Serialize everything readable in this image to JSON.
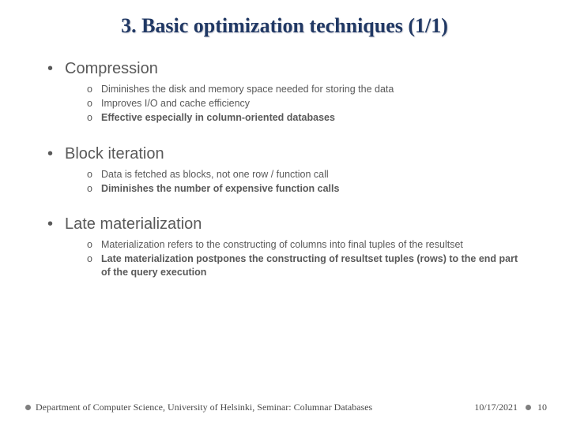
{
  "title": "3. Basic optimization techniques (1/1)",
  "sections": [
    {
      "heading": "Compression",
      "items": [
        {
          "text": "Diminishes the disk and memory space needed for storing the data",
          "bold": false
        },
        {
          "text": "Improves I/O and cache efficiency",
          "bold": false
        },
        {
          "text": "Effective especially in column-oriented databases",
          "bold": true
        }
      ]
    },
    {
      "heading": "Block iteration",
      "items": [
        {
          "text": "Data is fetched as blocks, not one row / function call",
          "bold": false
        },
        {
          "text": "Diminishes the number of expensive function calls",
          "bold": true
        }
      ]
    },
    {
      "heading": "Late materialization",
      "items": [
        {
          "text": "Materialization refers to the constructing of columns into final tuples of the resultset",
          "bold": false
        },
        {
          "text": "Late materialization postpones the constructing of resultset tuples (rows) to the end part of the query execution",
          "bold": true
        }
      ]
    }
  ],
  "footer": {
    "department": "Department of Computer Science, University of Helsinki, Seminar: Columnar Databases",
    "date": "10/17/2021",
    "page": "10"
  }
}
